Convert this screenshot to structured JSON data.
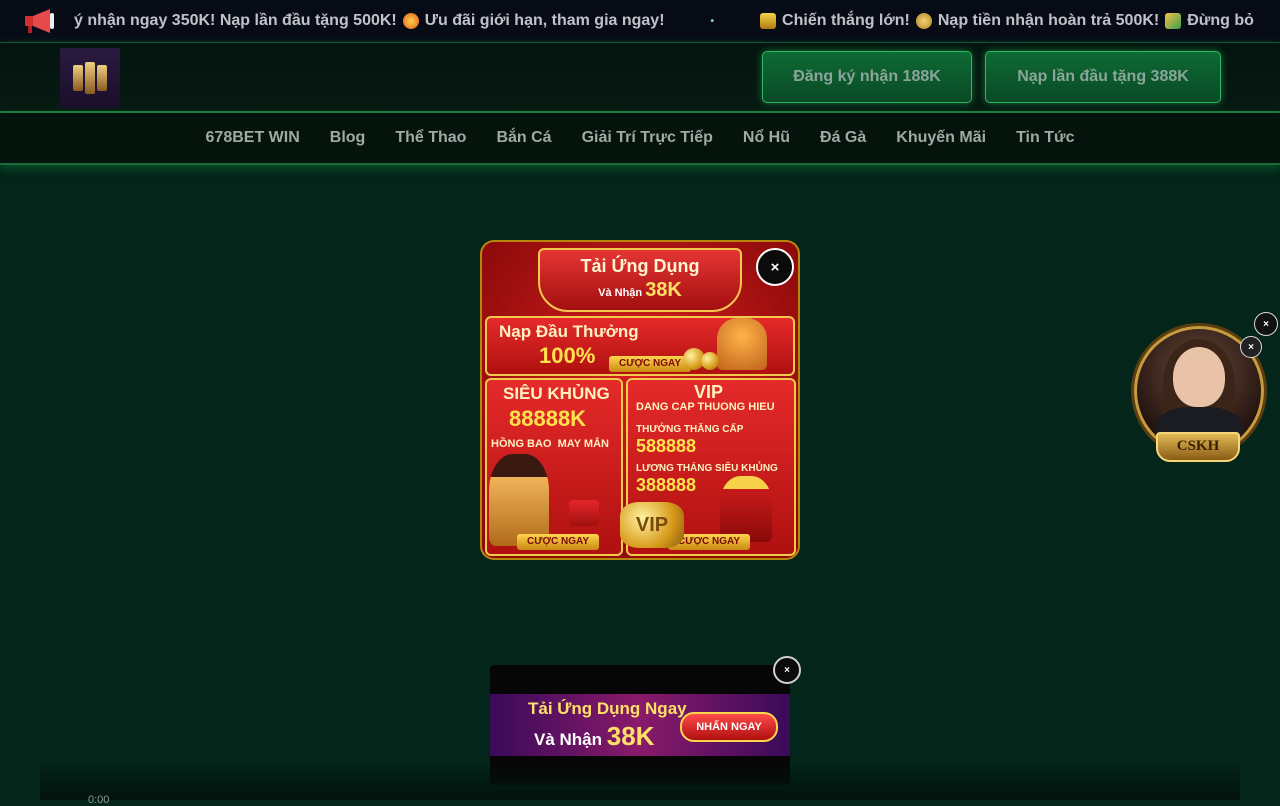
{
  "ticker": {
    "segment_1": "ý nhận ngay 350K! Nạp lần đầu tặng 500K!",
    "segment_2": "Ưu đãi giới hạn, tham gia ngay!",
    "separator": "•",
    "segment_3": "Chiến thắng lớn!",
    "segment_4": "Nạp tiền nhận hoàn trả 500K!",
    "segment_5": "Đừng bỏ"
  },
  "header": {
    "register_button": "Đăng ký nhận 188K",
    "deposit_button": "Nạp lần đầu tặng 388K"
  },
  "nav": {
    "items": [
      "678BET WIN",
      "Blog",
      "Thể Thao",
      "Bắn Cá",
      "Giải Trí Trực Tiếp",
      "Nổ Hũ",
      "Đá Gà",
      "Khuyến Mãi",
      "Tin Tức"
    ]
  },
  "popup": {
    "title": "Tải Ứng Dụng",
    "subtitle_prefix": "Và Nhận",
    "subtitle_amount": "38K",
    "deposit_title": "Nạp Đầu Thưởng",
    "deposit_percent": "100%",
    "bet_now": "CƯỢC NGAY",
    "super_title": "SIÊU KHỦNG",
    "super_amount": "88888K",
    "lucky_envelope": "HỒNG BAO  MAY MẮN",
    "vip_title": "VIP",
    "vip_subtitle": "DANG CAP THUONG HIEU",
    "promotion_bonus_label": "THƯỞNG THĂNG CẤP",
    "promotion_bonus_amount": "588888",
    "monthly_salary_label": "LƯƠNG THÁNG SIÊU KHỦNG",
    "monthly_salary_amount": "388888",
    "vip_badge": "VIP"
  },
  "close_symbol": "×",
  "support": {
    "label": "CSKH"
  },
  "bottom_banner": {
    "line1": "Tải Ứng Dụng Ngay",
    "line2_prefix": "Và Nhận",
    "line2_amount": "38K",
    "button": "NHẤN NGAY"
  },
  "video": {
    "time": "0:00"
  },
  "colors": {
    "background": "#03251a",
    "accent_green": "#2fb862",
    "popup_red": "#d81e1e",
    "gold": "#f2c94c"
  }
}
